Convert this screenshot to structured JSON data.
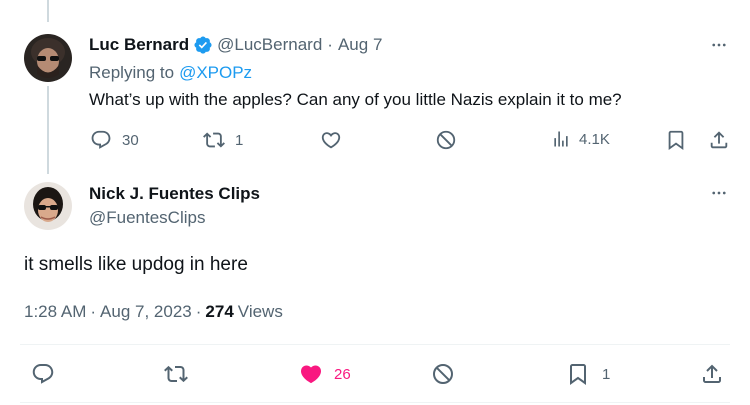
{
  "reply": {
    "author_name": "Luc Bernard",
    "handle": "@LucBernard",
    "separator": "·",
    "date": "Aug 7",
    "replying_to_label": "Replying to",
    "replying_to_handle": "@XPOPz",
    "text": "What’s up with the apples? Can any of you little Nazis explain it to me?",
    "stats": {
      "replies": "30",
      "reposts": "1",
      "views": "4.1K"
    }
  },
  "main": {
    "author_name": "Nick J. Fuentes Clips",
    "handle": "@FuentesClips",
    "text": "it smells like updog in here",
    "time": "1:28 AM",
    "dot": "·",
    "date": "Aug 7, 2023",
    "views_count": "274",
    "views_label": "Views",
    "stats": {
      "likes": "26",
      "bookmarks": "1"
    }
  },
  "colors": {
    "accent": "#1d9bf0",
    "like": "#f91880",
    "muted": "#536471",
    "text": "#0f1419",
    "line": "#cfd9de"
  },
  "icons": [
    "verified-badge-icon",
    "more-icon",
    "reply-icon",
    "repost-icon",
    "like-icon",
    "block-icon",
    "views-icon",
    "bookmark-icon",
    "share-icon"
  ]
}
